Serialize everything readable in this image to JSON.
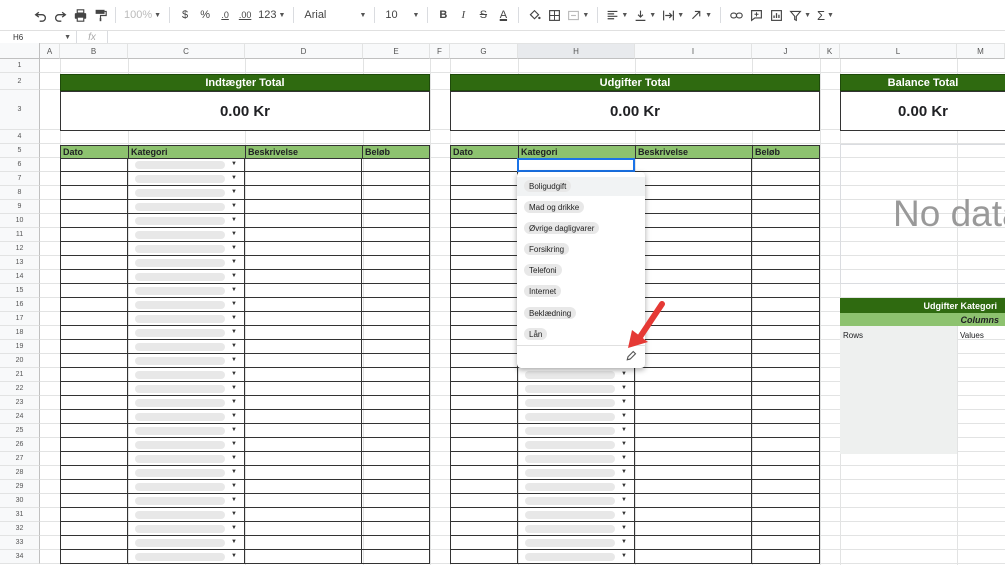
{
  "toolbar": {
    "zoom": "100%",
    "currency": "$",
    "percent": "%",
    "dec_decrease": ".0",
    "dec_increase": ".00",
    "format_more": "123",
    "font": "Arial",
    "font_size": "10",
    "bold": "B",
    "italic": "I",
    "strike": "S",
    "text_color": "A"
  },
  "formula_bar": {
    "name_box": "H6",
    "fx": "fx",
    "value": ""
  },
  "columns": [
    "A",
    "B",
    "C",
    "D",
    "E",
    "F",
    "G",
    "H",
    "I",
    "J",
    "K",
    "L",
    "M"
  ],
  "selected_column": "H",
  "rows": [
    "1",
    "2",
    "3",
    "4",
    "5",
    "6",
    "7",
    "8",
    "9",
    "10",
    "11",
    "12",
    "13",
    "14",
    "15",
    "16",
    "17",
    "18",
    "19",
    "20",
    "21",
    "22",
    "23",
    "24",
    "25",
    "26",
    "27",
    "28",
    "29",
    "30",
    "31",
    "32",
    "33",
    "34"
  ],
  "income": {
    "title": "Indtægter Total",
    "total": "0.00 Kr",
    "headers": [
      "Dato",
      "Kategori",
      "Beskrivelse",
      "Beløb"
    ]
  },
  "expenses": {
    "title": "Udgifter Total",
    "total": "0.00 Kr",
    "headers": [
      "Dato",
      "Kategori",
      "Beskrivelse",
      "Beløb"
    ]
  },
  "balance": {
    "title": "Balance Total",
    "total": "0.00 Kr"
  },
  "chart": {
    "placeholder": "No data"
  },
  "pivot": {
    "title": "Udgifter Kategori",
    "columns_label": "Columns",
    "rows_label": "Rows",
    "values_label": "Values"
  },
  "dropdown": {
    "options": [
      "Boligudgift",
      "Mad og drikke",
      "Øvrige dagligvarer",
      "Forsikring",
      "Telefoni",
      "Internet",
      "Beklædning",
      "Lån"
    ],
    "edit_icon": "pencil-icon"
  },
  "colors": {
    "header_dark_green": "#2f6a10",
    "header_light_green": "#8dc26f",
    "selection_blue": "#1a73e8",
    "arrow_red": "#e53935"
  }
}
